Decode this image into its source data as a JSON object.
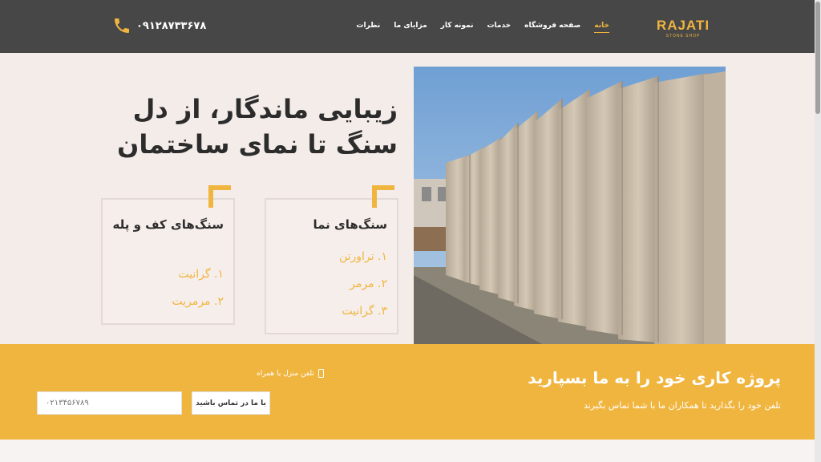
{
  "header": {
    "logo": {
      "main": "RAJATI",
      "sub": "STONE SHOP"
    },
    "nav": [
      "خانه",
      "صفحه فروشگاه",
      "خدمات",
      "نمونه کار",
      "مزایای ما",
      "نظرات"
    ],
    "phone": "۰۹۱۲۸۷۳۳۶۷۸"
  },
  "hero": {
    "title": "زیبایی ماندگار، از دل سنگ تا نمای ساختمان",
    "cards": [
      {
        "title": "سنگ‌های نما",
        "items": [
          "۱. تراورتن",
          "۲. مرمر",
          "۳. گرانیت"
        ]
      },
      {
        "title": "سنگ‌های کف و پله",
        "items": [
          "۱. گرانیت",
          "۲. مرمریت"
        ]
      }
    ]
  },
  "cta": {
    "title": "پروژه کاری خود را به ما بسپارید",
    "subtitle": "تلفن خود را بگذارید تا همکاران ما با شما تماس بگیرند",
    "field_label": "تلفن منزل یا همراه",
    "input_placeholder": "۰۲۱۳۴۵۶۷۸۹",
    "button": "با ما در تماس باشید"
  },
  "colors": {
    "accent": "#f0b53f",
    "header_bg": "#474747",
    "hero_bg": "#f4ece9"
  },
  "icons": {
    "phone": "phone-icon",
    "mobile": "mobile-icon"
  }
}
